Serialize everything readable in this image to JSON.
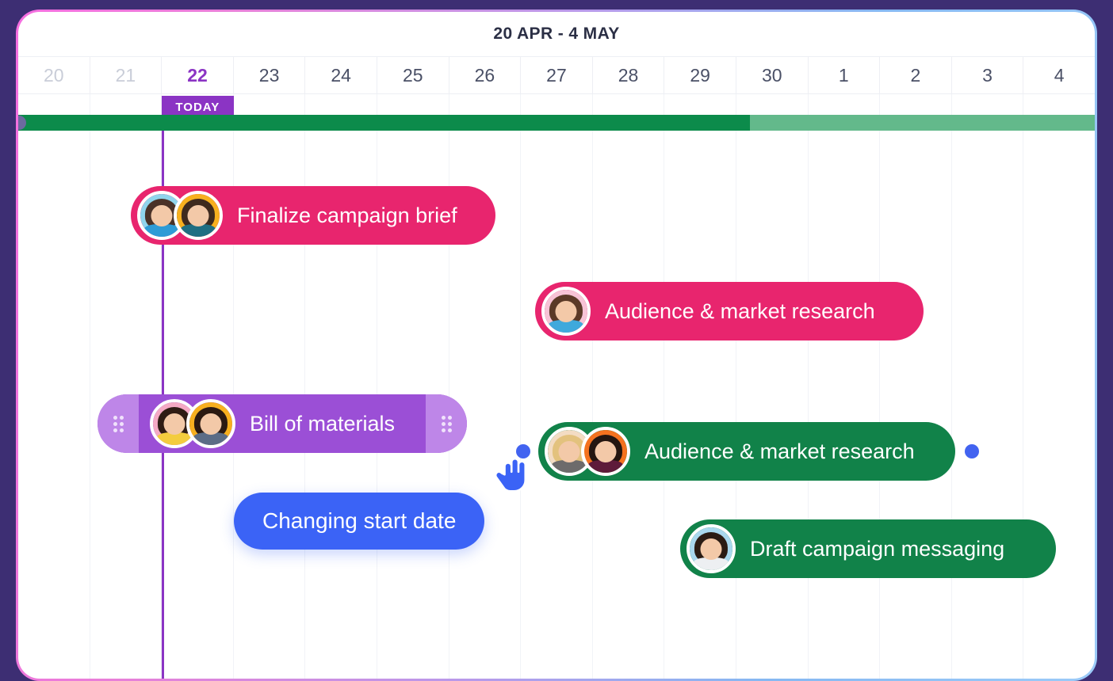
{
  "header": {
    "title": "20 APR - 4 MAY"
  },
  "timeline": {
    "today_label": "TODAY",
    "today_index": 2,
    "days": [
      {
        "label": "20",
        "state": "past"
      },
      {
        "label": "21",
        "state": "past"
      },
      {
        "label": "22",
        "state": "today"
      },
      {
        "label": "23",
        "state": "future"
      },
      {
        "label": "24",
        "state": "future"
      },
      {
        "label": "25",
        "state": "future"
      },
      {
        "label": "26",
        "state": "future"
      },
      {
        "label": "27",
        "state": "future"
      },
      {
        "label": "28",
        "state": "future"
      },
      {
        "label": "29",
        "state": "future"
      },
      {
        "label": "30",
        "state": "future"
      },
      {
        "label": "1",
        "state": "future"
      },
      {
        "label": "2",
        "state": "future"
      },
      {
        "label": "3",
        "state": "future"
      },
      {
        "label": "4",
        "state": "future"
      }
    ]
  },
  "progress_bar": {
    "done_color": "#0C8B4B",
    "remaining_color": "#63B98B",
    "done_percent": 68
  },
  "colors": {
    "pink": "#E8256E",
    "green": "#118249",
    "purple": "#9B4FD6",
    "purple_handle": "#BE86E8",
    "today": "#8B34C4",
    "blue": "#3B63F6",
    "frame": "#3D2E73"
  },
  "tasks": [
    {
      "label": "Finalize campaign brief",
      "color": "pink",
      "avatars": [
        {
          "bg": "#8FD4EC",
          "hair": "#4A3228",
          "body": "#2E9BD6"
        },
        {
          "bg": "#F7B01F",
          "hair": "#3E2A1E",
          "body": "#1F6E82"
        }
      ]
    },
    {
      "label": "Audience & market research",
      "color": "pink",
      "avatars": [
        {
          "bg": "#F7C3D6",
          "hair": "#5B3A27",
          "body": "#3FA9DC"
        }
      ]
    },
    {
      "label": "Bill of materials",
      "color": "purple",
      "resizable": true,
      "avatars": [
        {
          "bg": "#F4A9C4",
          "hair": "#2F1C14",
          "body": "#F3CC3E"
        },
        {
          "bg": "#F7B01F",
          "hair": "#2B1A12",
          "body": "#5B6C86"
        }
      ]
    },
    {
      "label": "Audience & market research",
      "color": "green",
      "connectors": true,
      "avatars": [
        {
          "bg": "#F3DCC3",
          "hair": "#E3C27E",
          "body": "#6D6B6B"
        },
        {
          "bg": "#F4721F",
          "hair": "#241610",
          "body": "#5E1B3A"
        }
      ]
    },
    {
      "label": "Draft campaign messaging",
      "color": "green",
      "avatars": [
        {
          "bg": "#A9D8EE",
          "hair": "#2B1C14",
          "body": "#EDEFF2"
        }
      ]
    }
  ],
  "tooltip": {
    "label": "Changing start date"
  }
}
